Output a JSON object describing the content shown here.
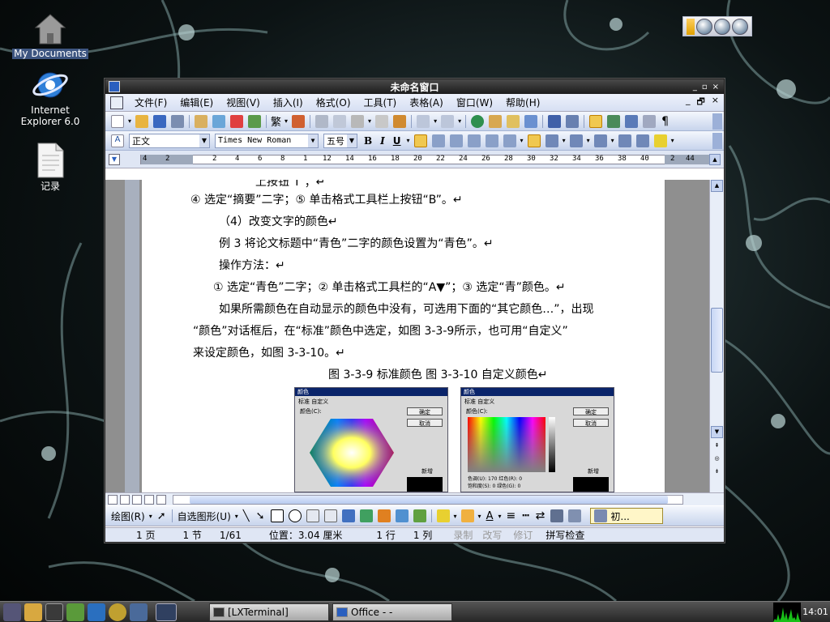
{
  "desktop": {
    "icons": [
      {
        "label": "My Documents"
      },
      {
        "label_line1": "Internet",
        "label_line2": "Explorer 6.0"
      },
      {
        "label": "记录"
      }
    ]
  },
  "window": {
    "title": "未命名窗口",
    "controls": [
      "_",
      "▫",
      "×"
    ]
  },
  "menu": {
    "items": [
      "文件(F)",
      "编辑(E)",
      "视图(V)",
      "插入(I)",
      "格式(O)",
      "工具(T)",
      "表格(A)",
      "窗口(W)",
      "帮助(H)"
    ],
    "right_controls": [
      "_",
      "🗗",
      "×"
    ]
  },
  "format_toolbar": {
    "style_value": "正文",
    "font_value": "Times New Roman",
    "size_value": "五号",
    "bold": "B",
    "italic": "I",
    "underline": "U"
  },
  "standard_toolbar": {
    "traditional": "繁"
  },
  "ruler": {
    "numbers": [
      "4",
      "2",
      "2",
      "4",
      "6",
      "8",
      "1",
      "12",
      "14",
      "16",
      "18",
      "20",
      "22",
      "24",
      "26",
      "28",
      "30",
      "32",
      "34",
      "36",
      "38",
      "40",
      "2",
      "44"
    ]
  },
  "document": {
    "lines": [
      "上按钮“I”；↵",
      "④ 选定“摘要”二字；⑤ 单击格式工具栏上按钮“B”。↵",
      "（4）改变文字的颜色↵",
      "例 3  将论文标题中“青色”二字的颜色设置为“青色”。↵",
      "操作方法：↵",
      "① 选定“青色”二字；② 单击格式工具栏的“A▼”；③ 选定“青”颜色。↵",
      "如果所需颜色在自动显示的颜色中没有，可选用下面的“其它颜色…”，出现",
      "“颜色”对话框后，在“标准”颜色中选定，如图 3-3-9所示，也可用“自定义”",
      "来设定颜色，如图 3-3-10。↵",
      "图 3-3-9  标准颜色          图 3-3-10  自定义颜色↵"
    ],
    "figure_left": {
      "title": "颜色",
      "tabs": [
        "标准",
        "自定义"
      ],
      "colors_label": "颜色(C):",
      "ok": "确定",
      "cancel": "取消",
      "new_label": "新增"
    },
    "figure_right": {
      "title": "颜色",
      "tabs": [
        "标准",
        "自定义"
      ],
      "colors_label": "颜色(C):",
      "ok": "确定",
      "cancel": "取消",
      "new_label": "新增",
      "fields": [
        "色调(U):",
        "饱和度(S):",
        "红色(R):",
        "绿色(G):"
      ],
      "field_values": [
        "170",
        "0",
        "0",
        "0"
      ]
    }
  },
  "drawing_toolbar": {
    "draw_label": "绘图(R)",
    "autoshape_label": "自选图形(U)",
    "init_label": "初..."
  },
  "status": {
    "page": "1 页",
    "section": "1 节",
    "pages": "1/61",
    "position": "位置：3.04 厘米",
    "line": "1 行",
    "column": "1 列",
    "rec": "录制",
    "trk": "改写",
    "ext": "修订",
    "spell": "拼写检查"
  },
  "taskbar": {
    "tasks": [
      "[LXTerminal]",
      "Office - -"
    ],
    "clock": "14:01"
  }
}
